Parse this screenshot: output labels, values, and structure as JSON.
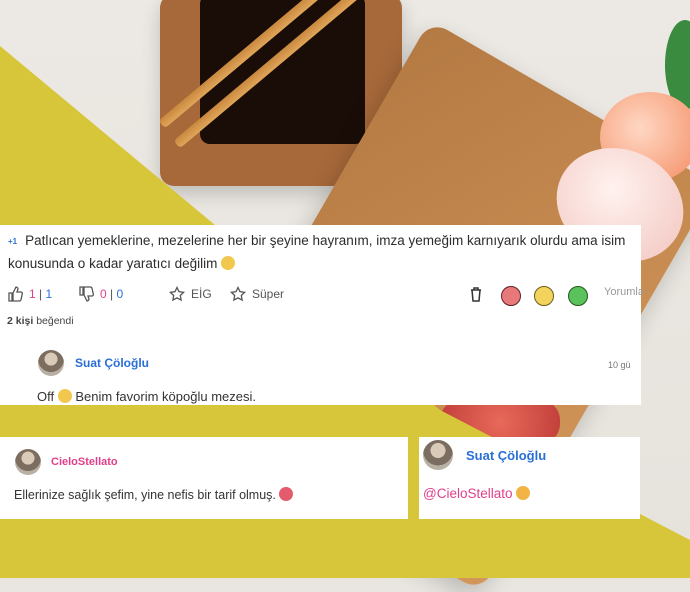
{
  "main_comment": {
    "tag": "+1",
    "text": "Patlıcan yemeklerine, mezelerine her bir şeyine hayranım, imza yemeğim karnıyarık olurdu ama isim konusunda o kadar yaratıcı değilim",
    "like_a": "1",
    "like_sep": "|",
    "like_b": "1",
    "dislike_a": "0",
    "dislike_sep": "|",
    "dislike_b": "0",
    "btn_eig": "EİG",
    "btn_super": "Süper",
    "btn_reply": "Yorumla",
    "likes_count": "2 kişi",
    "likes_suffix": "beğendi"
  },
  "reply_main": {
    "author": "Suat Çöloğlu",
    "time": "10 gü",
    "text": "Off",
    "text2": "Benim favorim köpoğlu mezesi."
  },
  "card_left": {
    "author": "CieloStellato",
    "text": "Ellerinize sağlık şefim, yine nefis bir tarif olmuş."
  },
  "card_right": {
    "author": "Suat Çöloğlu",
    "mention": "@CieloStellato"
  },
  "colors": {
    "yellow": "#d8c63a",
    "blue": "#2a6fd6",
    "pink": "#e0408a"
  },
  "icons": [
    "thumbs-up-icon",
    "thumbs-down-icon",
    "star-icon",
    "trash-icon",
    "angry-face-icon",
    "neutral-face-icon",
    "smile-face-icon",
    "laughing-emoji",
    "smirk-emoji",
    "flower-emoji",
    "pray-emoji"
  ]
}
